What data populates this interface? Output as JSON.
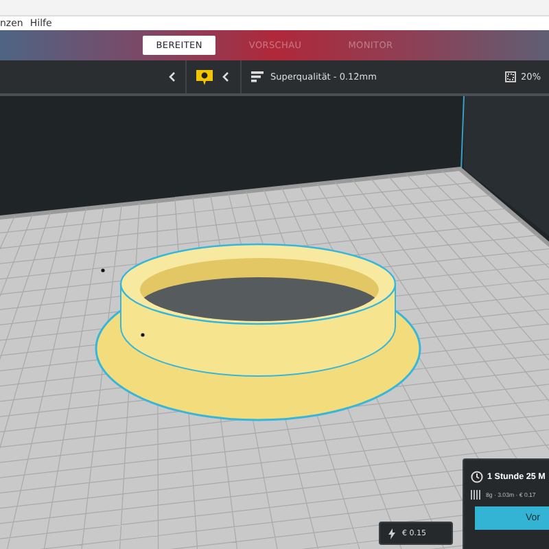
{
  "menu_bar": {
    "items": [
      {
        "label": "nzen"
      },
      {
        "label": "Hilfe"
      }
    ]
  },
  "stage_tabs": [
    {
      "label": "BEREITEN",
      "selected": true
    },
    {
      "label": "VORSCHAU",
      "selected": false
    },
    {
      "label": "MONITOR",
      "selected": false
    }
  ],
  "toolbar": {
    "profile": "Superqualität - 0.12mm",
    "infill": "20%"
  },
  "cost_badge": {
    "text": "€ 0.15"
  },
  "print_panel": {
    "time": "1 Stunde 25 M",
    "details": "8g · 3.03m · € 0.17",
    "button": "Vor"
  }
}
